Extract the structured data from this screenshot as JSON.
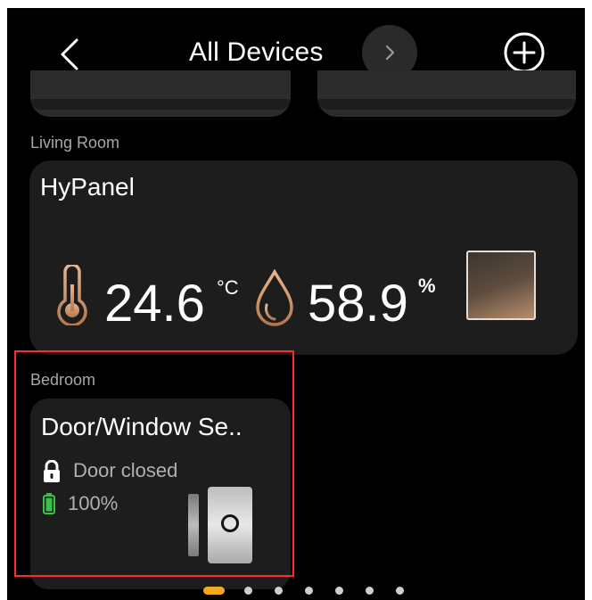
{
  "header": {
    "title": "All Devices"
  },
  "sections": {
    "living_room_label": "Living Room",
    "bedroom_label": "Bedroom"
  },
  "hypanel": {
    "name": "HyPanel",
    "temperature": "24.6",
    "temperature_unit": "°C",
    "humidity": "58.9",
    "humidity_unit": "%"
  },
  "door_sensor": {
    "name": "Door/Window Se..",
    "status": "Door closed",
    "battery": "100%"
  },
  "colors": {
    "accent": "#f5a623",
    "battery_green": "#39c24a",
    "highlight": "#ff2a2a",
    "card_bg": "#1d1d1d"
  },
  "pagination": {
    "total_pages": 7,
    "current_page": 1
  }
}
